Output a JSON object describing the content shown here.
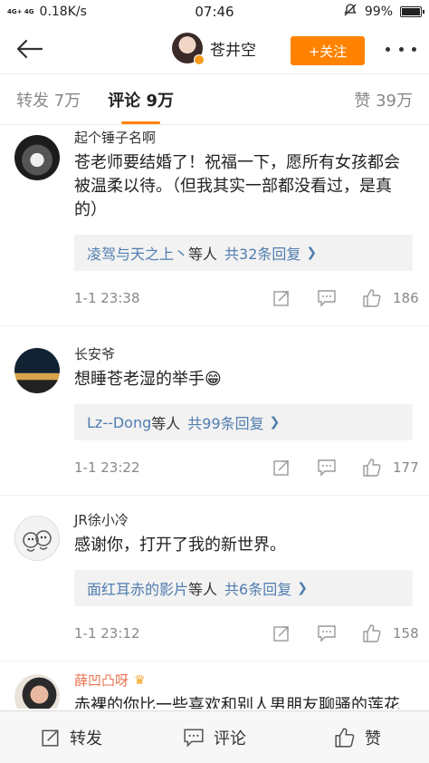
{
  "status_bar": {
    "network": "4G+ 4G",
    "speed": "0.18K/s",
    "time": "07:46",
    "battery": "99%",
    "battery_level": 0.99
  },
  "header": {
    "user_name": "苍井空",
    "follow_label": "+关注"
  },
  "tabs": {
    "reposts": "转发 7万",
    "comments": "评论 9万",
    "likes": "赞 39万"
  },
  "comments": [
    {
      "name": "起个锤子名啊",
      "text": "苍老师要结婚了！祝福一下，愿所有女孩都会被温柔以待。（但我其实一部都没看过，是真的）",
      "reply_users": "凌驾与天之上丶",
      "reply_mid": "等人",
      "reply_count": "共32条回复",
      "time": "1-1 23:38",
      "likes": "186"
    },
    {
      "name": "长安爷",
      "text": "想睡苍老湿的举手😁",
      "reply_users": "Lz--Dong",
      "reply_mid": "等人",
      "reply_count": "共99条回复",
      "time": "1-1 23:22",
      "likes": "177"
    },
    {
      "name": "JR徐小冷",
      "text": "感谢你，打开了我的新世界。",
      "reply_users": "面红耳赤的影片",
      "reply_mid": "等人",
      "reply_count": "共6条回复",
      "time": "1-1 23:12",
      "likes": "158"
    },
    {
      "name": "薛凹凸呀",
      "text": "赤裸的你比一些喜欢和别人男朋友聊骚的莲花婊好太多了，你值得尊重❤️"
    }
  ],
  "bottom_bar": {
    "repost": "转发",
    "comment": "评论",
    "like": "赞"
  },
  "colors": {
    "accent": "#ff8200",
    "link": "#507daf",
    "vip_name": "#eb7350"
  }
}
